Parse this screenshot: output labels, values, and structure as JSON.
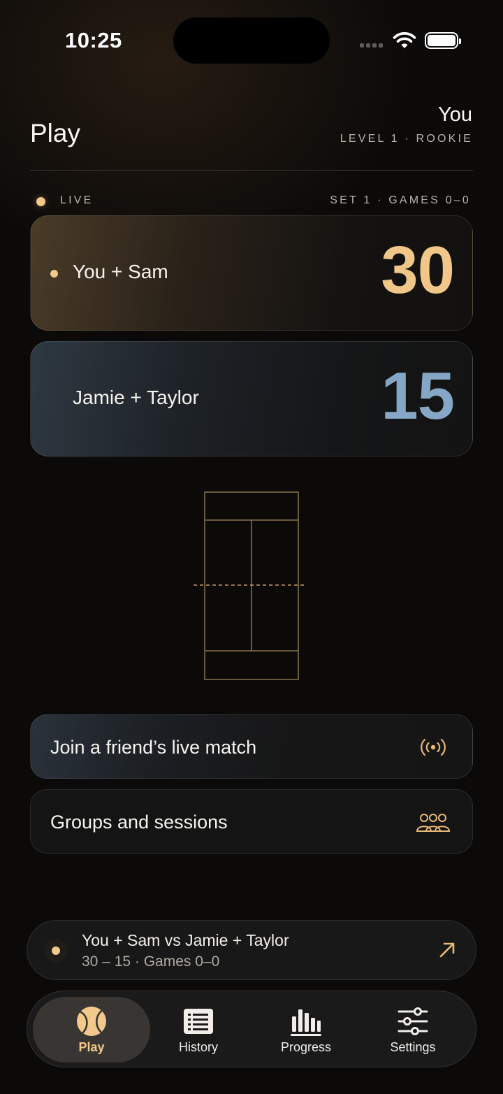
{
  "status_bar": {
    "time": "10:25"
  },
  "header": {
    "title": "Play",
    "user_name": "You",
    "user_level": "LEVEL 1 · ROOKIE"
  },
  "live": {
    "label": "LIVE",
    "set_info": "SET 1 · GAMES 0–0"
  },
  "teams": [
    {
      "name": "You + Sam",
      "score": "30",
      "serving": true,
      "color": "#f0c788"
    },
    {
      "name": "Jamie + Taylor",
      "score": "15",
      "serving": false,
      "color": "#86a6c6"
    }
  ],
  "actions": [
    {
      "label": "Join a friend’s live match",
      "icon": "broadcast-icon"
    },
    {
      "label": "Groups and sessions",
      "icon": "group-icon"
    }
  ],
  "now_playing": {
    "title": "You + Sam vs Jamie + Taylor",
    "subtitle": "30 – 15  ·  Games 0–0",
    "icon": "arrow-up-right-icon"
  },
  "tabs": [
    {
      "label": "Play",
      "icon": "tennis-ball-icon",
      "active": true
    },
    {
      "label": "History",
      "icon": "list-icon",
      "active": false
    },
    {
      "label": "Progress",
      "icon": "bar-chart-icon",
      "active": false
    },
    {
      "label": "Settings",
      "icon": "sliders-icon",
      "active": false
    }
  ],
  "colors": {
    "accent": "#f2c98b",
    "team_b": "#86a6c6",
    "background": "#0b0a09"
  }
}
